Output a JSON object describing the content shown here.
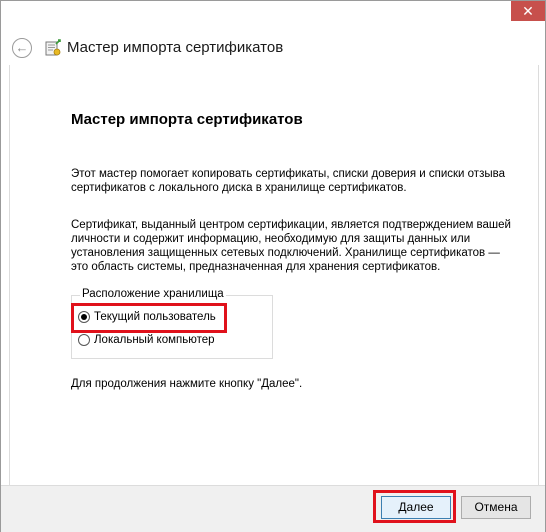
{
  "window": {
    "title": "Мастер импорта сертификатов",
    "close_glyph": "✕",
    "back_glyph": "←"
  },
  "page": {
    "heading": "Мастер импорта сертификатов",
    "intro": "Этот мастер помогает копировать сертификаты, списки доверия и списки отзыва сертификатов с локального диска в хранилище сертификатов.",
    "description": "Сертификат, выданный центром сертификации, является подтверждением вашей личности и содержит информацию, необходимую для защиты данных или установления защищенных сетевых подключений. Хранилище сертификатов — это область системы, предназначенная для хранения сертификатов.",
    "store_location": {
      "legend": "Расположение хранилища",
      "options": [
        {
          "label": "Текущий пользователь",
          "selected": true
        },
        {
          "label": "Локальный компьютер",
          "selected": false
        }
      ]
    },
    "continue_hint": "Для продолжения нажмите кнопку \"Далее\"."
  },
  "footer": {
    "next_label": "Далее",
    "cancel_label": "Отмена"
  },
  "colors": {
    "highlight": "#e0111b",
    "close_button": "#c7504c"
  },
  "icons": [
    "close-icon",
    "back-arrow-icon",
    "certificate-icon"
  ]
}
